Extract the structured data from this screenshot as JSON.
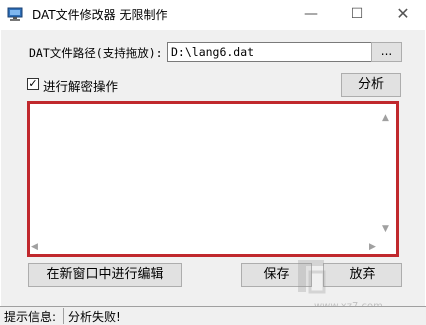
{
  "window": {
    "title": "DAT文件修改器  无限制作",
    "icon": "monitor-icon",
    "minimize_glyph": "—",
    "maximize_glyph": "☐",
    "close_glyph": "✕"
  },
  "path": {
    "label": "DAT文件路径(支持拖放):",
    "value": "D:\\lang6.dat",
    "browse_label": "..."
  },
  "decrypt": {
    "checked": true,
    "check_glyph": "✓",
    "label": "进行解密操作"
  },
  "analyze_label": "分析",
  "editor": {
    "content": "",
    "border_color": "#c0282d",
    "scroll_up": "▲",
    "scroll_down": "▼",
    "scroll_left": "◀",
    "scroll_right": "▶"
  },
  "actions": {
    "edit_new_window": "在新窗口中进行编辑",
    "save": "保存",
    "discard": "放弃"
  },
  "status": {
    "label": "提示信息:",
    "value": "分析失败!"
  },
  "watermark": {
    "logo_name": "watermark-logo",
    "url": "www.xz7.com"
  }
}
